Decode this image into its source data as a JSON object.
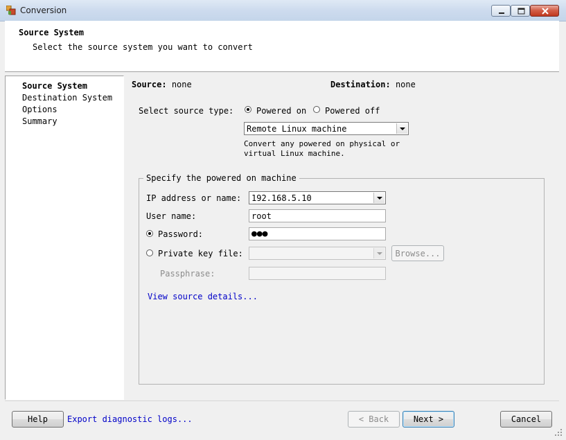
{
  "window": {
    "title": "Conversion",
    "icon": "vmware-converter-icon"
  },
  "header": {
    "title": "Source System",
    "subtitle": "Select the source system you want to convert"
  },
  "nav": {
    "items": [
      {
        "label": "Source System",
        "active": true
      },
      {
        "label": "Destination System",
        "active": false
      },
      {
        "label": "Options",
        "active": false
      },
      {
        "label": "Summary",
        "active": false
      }
    ]
  },
  "summary": {
    "source_label": "Source:",
    "source_value": "none",
    "destination_label": "Destination:",
    "destination_value": "none"
  },
  "source_type": {
    "label": "Select source type:",
    "powered_on": "Powered on",
    "powered_off": "Powered off",
    "selected": "Powered on",
    "combo_value": "Remote Linux machine",
    "description_line1": "Convert any powered on physical or",
    "description_line2": "virtual Linux machine."
  },
  "machine": {
    "group_title": "Specify the powered on machine",
    "ip_label": "IP address or name:",
    "ip_value": "192.168.5.10",
    "user_label": "User name:",
    "user_value": "root",
    "password_label": "Password:",
    "password_value": "●●●",
    "key_label": "Private key file:",
    "key_value": "",
    "browse_label": "Browse...",
    "passphrase_label": "Passphrase:",
    "passphrase_value": "",
    "details_link": "View source details..."
  },
  "footer": {
    "help": "Help",
    "export": "Export diagnostic logs...",
    "back": "< Back",
    "next": "Next >",
    "cancel": "Cancel"
  }
}
